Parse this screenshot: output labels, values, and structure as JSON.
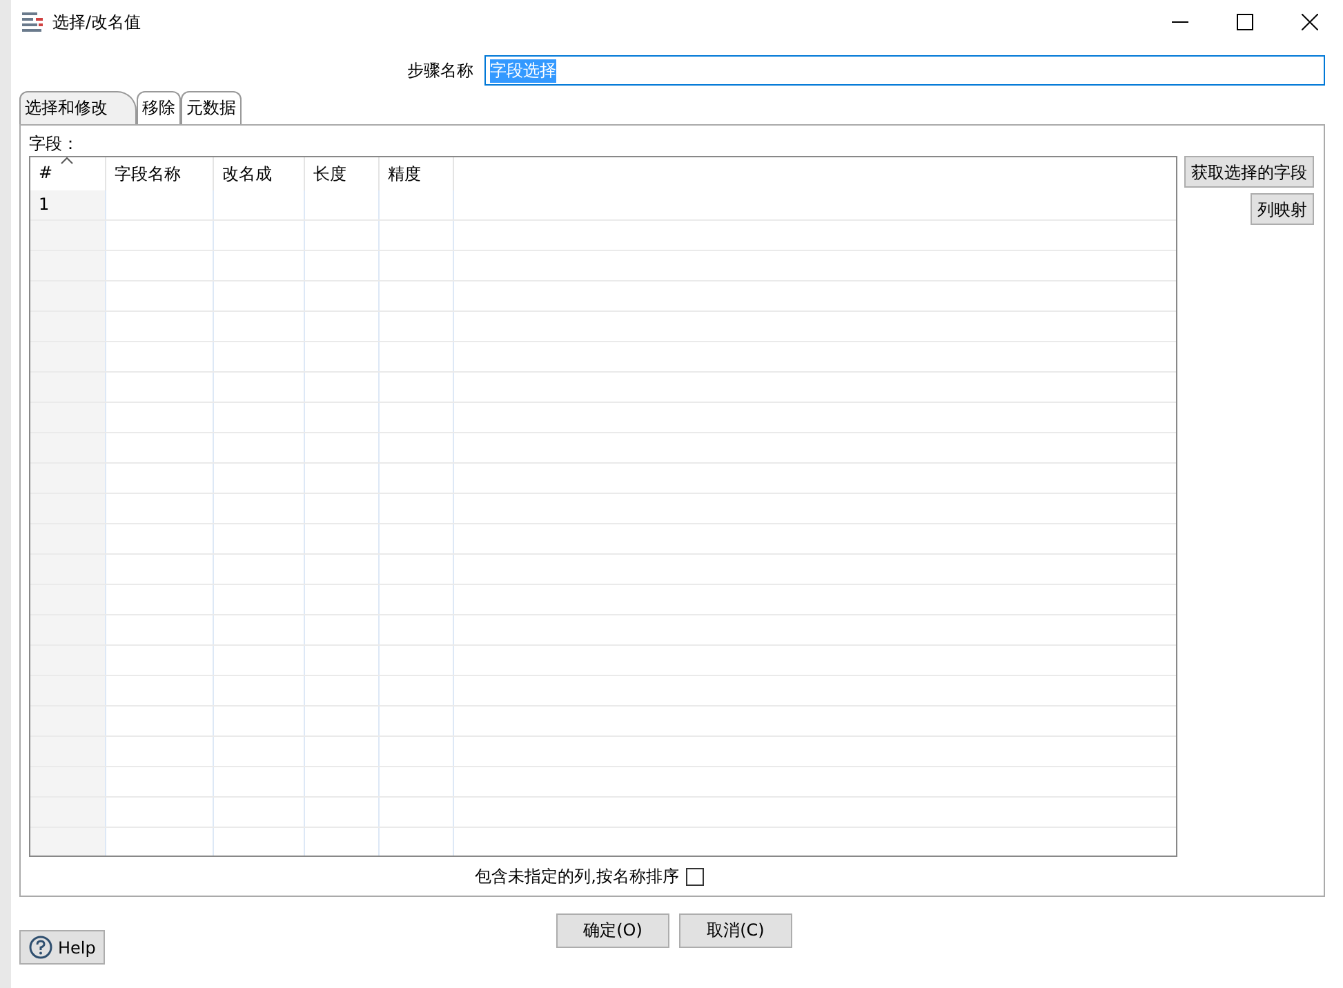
{
  "window": {
    "title": "选择/改名值"
  },
  "step_name": {
    "label": "步骤名称",
    "value": "字段选择"
  },
  "tabs": [
    {
      "label": "选择和修改",
      "selected": true
    },
    {
      "label": "移除",
      "selected": false
    },
    {
      "label": "元数据",
      "selected": false
    }
  ],
  "fields_label": "字段：",
  "table": {
    "columns": [
      "#",
      "字段名称",
      "改名成",
      "长度",
      "精度"
    ],
    "rows": [
      [
        "1",
        "",
        "",
        "",
        ""
      ]
    ]
  },
  "side_buttons": [
    "获取选择的字段",
    "列映射"
  ],
  "include_unspecified": {
    "label": "包含未指定的列,按名称排序",
    "checked": false
  },
  "buttons": [
    "确定(O)",
    "取消(C)"
  ],
  "help_button": "Help"
}
